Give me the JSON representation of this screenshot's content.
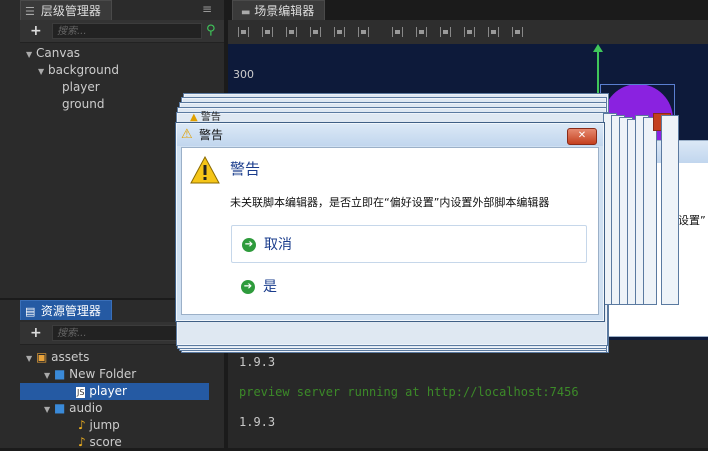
{
  "hierarchy": {
    "tab_label": "层级管理器",
    "search_placeholder": "搜索...",
    "tree": [
      "Canvas",
      "background",
      "player",
      "ground"
    ]
  },
  "assets": {
    "tab_label": "资源管理器",
    "search_placeholder": "搜索...",
    "tree": [
      "assets",
      "New Folder",
      "player",
      "audio",
      "jump",
      "score"
    ]
  },
  "scene": {
    "tab_label": "场景编辑器",
    "ruler_value": "300"
  },
  "console": {
    "lines": [
      "1.9.3",
      "preview server running at http://localhost:7456",
      "1.9.3"
    ],
    "colors": {
      "normal": "#c8c8c8",
      "success": "#3c8a28"
    }
  },
  "dialog": {
    "title": "警告",
    "heading": "警告",
    "message": "未关联脚本编辑器，是否立即在“偏好设置”内设置外部脚本编辑器",
    "options": [
      "取消",
      "是"
    ],
    "back_title": "警告",
    "side_text": "设置”"
  },
  "colors": {
    "selection": "#255aa3",
    "scene_bg": "#0d1a3a",
    "gizmo_green": "#3fc65a",
    "circle_purple": "#8a22e0"
  }
}
